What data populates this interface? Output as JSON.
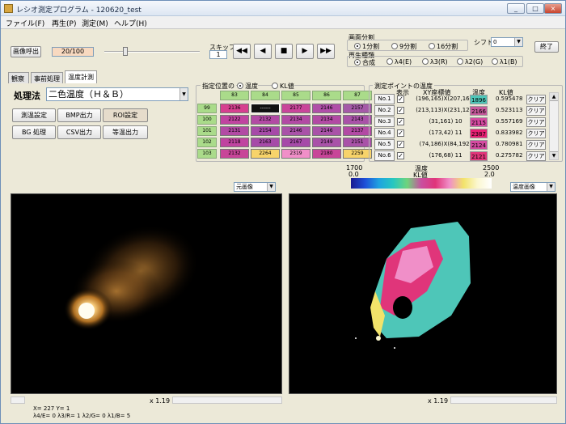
{
  "window": {
    "title": "レシオ測定プログラム - 120620_test",
    "minimize": "_",
    "maximize": "□",
    "close": "×"
  },
  "menu": [
    "ファイル(F)",
    "再生(P)",
    "測定(M)",
    "ヘルプ(H)"
  ],
  "toolbar": {
    "image_load": "画像呼出",
    "frame_counter": "20/100",
    "skip_label": "スキップ",
    "skip_value": "1",
    "rewind": "◀◀",
    "prev": "◀",
    "stop": "■",
    "play": "▶",
    "forward": "▶▶",
    "exit": "終了"
  },
  "screen_split": {
    "label": "画面分割",
    "options": [
      "1分割",
      "9分割",
      "16分割"
    ],
    "selected": "1分割"
  },
  "playback_type": {
    "label": "再生種類",
    "options": [
      "合成",
      "λ4(E)",
      "λ3(R)",
      "λ2(G)",
      "λ1(B)"
    ],
    "selected": "合成"
  },
  "shift": {
    "label": "シフト",
    "value": "0"
  },
  "tabs": [
    "観察",
    "事前処理",
    "温度計測"
  ],
  "active_tab": "温度計測",
  "method": {
    "label": "処理法",
    "value": "二色温度（Ｈ＆Ｂ）"
  },
  "action_buttons": [
    "測温設定",
    "BMP出力",
    "ROI設定",
    "BG 処理",
    "CSV出力",
    "等温出力"
  ],
  "position_grid": {
    "label": "指定位置の",
    "radio_options": [
      "温度",
      "KL値"
    ],
    "selected": "温度",
    "col_headers": [
      "83",
      "84",
      "85",
      "86",
      "87"
    ],
    "row_headers": [
      "99",
      "100",
      "101",
      "102",
      "103"
    ],
    "cells": [
      [
        "2136",
        "------",
        "2177",
        "2146",
        "2157"
      ],
      [
        "2122",
        "2132",
        "2134",
        "2134",
        "2143"
      ],
      [
        "2131",
        "2154",
        "2146",
        "2146",
        "2137"
      ],
      [
        "2118",
        "2163",
        "2167",
        "2149",
        "2151"
      ],
      [
        "2132",
        "2264",
        "2319",
        "2180",
        "2259"
      ]
    ],
    "cell_colors": [
      [
        "#d6408f",
        "#111111",
        "#c9459a",
        "#b04ea8",
        "#a55aa8"
      ],
      [
        "#c044a0",
        "#b24aa4",
        "#b24aa4",
        "#b24aa4",
        "#a952a8"
      ],
      [
        "#b24aa4",
        "#a64aa8",
        "#a952a8",
        "#a952a8",
        "#b24aa4"
      ],
      [
        "#c044a0",
        "#a64aa8",
        "#a64aa8",
        "#a952a8",
        "#a952a8"
      ],
      [
        "#c84598",
        "#f7d36a",
        "#f08fc8",
        "#c84598",
        "#f7d36a"
      ]
    ]
  },
  "measure_points": {
    "label": "測定ポイントの温度",
    "headers": {
      "display": "表示",
      "xy": "XY座標値",
      "temp": "温度",
      "kl": "KL値"
    },
    "rows": [
      {
        "no": "No.1",
        "xy": "(196,165)X(207,168)",
        "temp": "1896",
        "kl": "0.595478",
        "color": "#4ec6b8"
      },
      {
        "no": "No.2",
        "xy": "(213,113)X(231,128)",
        "temp": "2166",
        "kl": "0.523113",
        "color": "#c75a9c"
      },
      {
        "no": "No.3",
        "xy": "(31,161) 10",
        "temp": "2115",
        "kl": "0.557169",
        "color": "#d44aa0"
      },
      {
        "no": "No.4",
        "xy": "(173,42) 11",
        "temp": "2387",
        "kl": "0.833982",
        "color": "#e81f73"
      },
      {
        "no": "No.5",
        "xy": "(74,186)X(84,192)",
        "temp": "2124",
        "kl": "0.780981",
        "color": "#d44aa0"
      },
      {
        "no": "No.6",
        "xy": "(176,68) 11",
        "temp": "2121",
        "kl": "0.275782",
        "color": "#e0357a"
      }
    ],
    "clear": "クリア"
  },
  "colorbar": {
    "temp_label": "温度",
    "kl_label": "KL値",
    "temp_min": "1700",
    "temp_max": "2500",
    "kl_min": "0.0",
    "kl_max": "2.0"
  },
  "left_view": {
    "select": "元画像",
    "zoom": "x 1.19"
  },
  "right_view": {
    "select": "温度画像",
    "zoom": "x 1.19"
  },
  "status": {
    "line1": "X= 227 Y= 1",
    "line2": "λ4/E= 0 λ3/R= 1 λ2/G= 0 λ1/B= 5"
  }
}
